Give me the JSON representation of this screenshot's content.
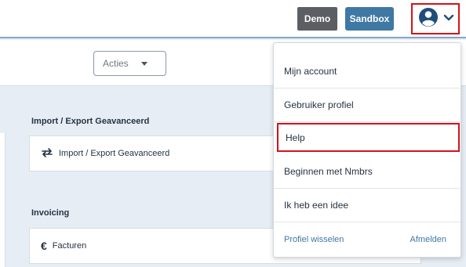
{
  "header": {
    "demo_label": "Demo",
    "sandbox_label": "Sandbox",
    "user_icon": "user-circle-icon",
    "chevron_icon": "chevron-down-icon"
  },
  "toolbar": {
    "actions_label": "Acties"
  },
  "sections": [
    {
      "title": "Import / Export Geavanceerd",
      "card_label": "Import / Export Geavanceerd",
      "icon": "swap-arrows-icon"
    },
    {
      "title": "Invoicing",
      "card_label": "Facturen",
      "icon": "euro-icon"
    }
  ],
  "user_dropdown": {
    "items": [
      "Mijn account",
      "Gebruiker profiel",
      "Help",
      "Beginnen met Nmbrs",
      "Ik heb een idee"
    ],
    "switch_profile": "Profiel wisselen",
    "logout": "Afmelden"
  },
  "colors": {
    "highlight": "#d4121a",
    "demo": "#5b5f63",
    "sandbox": "#3f78a3",
    "background": "#e7edf4"
  }
}
